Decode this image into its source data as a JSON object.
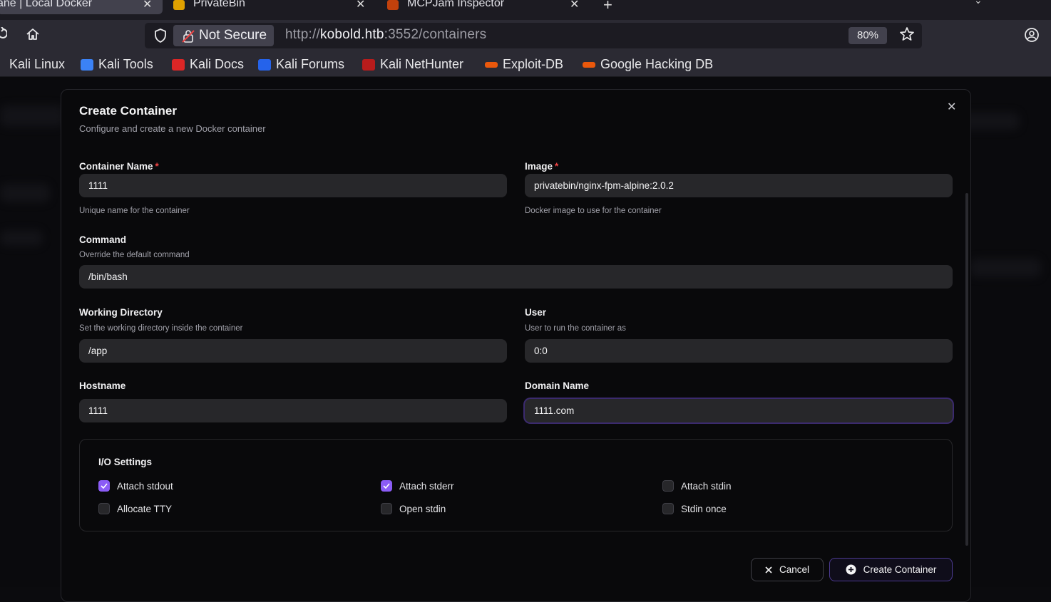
{
  "browser": {
    "tabs": [
      {
        "title": "ane | Local Docker"
      },
      {
        "title": "PrivateBin"
      },
      {
        "title": "MCPJam Inspector"
      }
    ],
    "url_bar": {
      "security_label": "Not Secure",
      "url_prefix": "http://",
      "url_host": "kobold.htb",
      "url_rest": ":3552/containers",
      "zoom": "80%"
    },
    "bookmarks": [
      {
        "label": "Kali Linux",
        "icon": "kali-dragon-icon"
      },
      {
        "label": "Kali Tools",
        "icon": "kali-tools-icon"
      },
      {
        "label": "Kali Docs",
        "icon": "kali-docs-icon"
      },
      {
        "label": "Kali Forums",
        "icon": "kali-forums-icon"
      },
      {
        "label": "Kali NetHunter",
        "icon": "kali-nethunter-icon"
      },
      {
        "label": "Exploit-DB",
        "icon": "exploit-db-icon"
      },
      {
        "label": "Google Hacking DB",
        "icon": "ghdb-icon"
      }
    ]
  },
  "modal": {
    "title": "Create Container",
    "description": "Configure and create a new Docker container",
    "fields": {
      "container_name": {
        "label": "Container Name",
        "value": "1111",
        "help": "Unique name for the container"
      },
      "image": {
        "label": "Image",
        "value": "privatebin/nginx-fpm-alpine:2.0.2",
        "help": "Docker image to use for the container"
      },
      "command": {
        "label": "Command",
        "help": "Override the default command",
        "value": "/bin/bash"
      },
      "working_directory": {
        "label": "Working Directory",
        "help": "Set the working directory inside the container",
        "value": "/app"
      },
      "user": {
        "label": "User",
        "help": "User to run the container as",
        "value": "0:0"
      },
      "hostname": {
        "label": "Hostname",
        "value": "1111"
      },
      "domain_name": {
        "label": "Domain Name",
        "value": "1111.com"
      }
    },
    "io_settings": {
      "title": "I/O Settings",
      "options": [
        {
          "label": "Attach stdout",
          "checked": true
        },
        {
          "label": "Attach stderr",
          "checked": true
        },
        {
          "label": "Attach stdin",
          "checked": false
        },
        {
          "label": "Allocate TTY",
          "checked": false
        },
        {
          "label": "Open stdin",
          "checked": false
        },
        {
          "label": "Stdin once",
          "checked": false
        }
      ]
    },
    "buttons": {
      "cancel": "Cancel",
      "create": "Create Container"
    },
    "required_marker": "*"
  },
  "colors": {
    "accent": "#8b5cf6",
    "required": "#ef4444",
    "input_bg": "#27272a"
  }
}
